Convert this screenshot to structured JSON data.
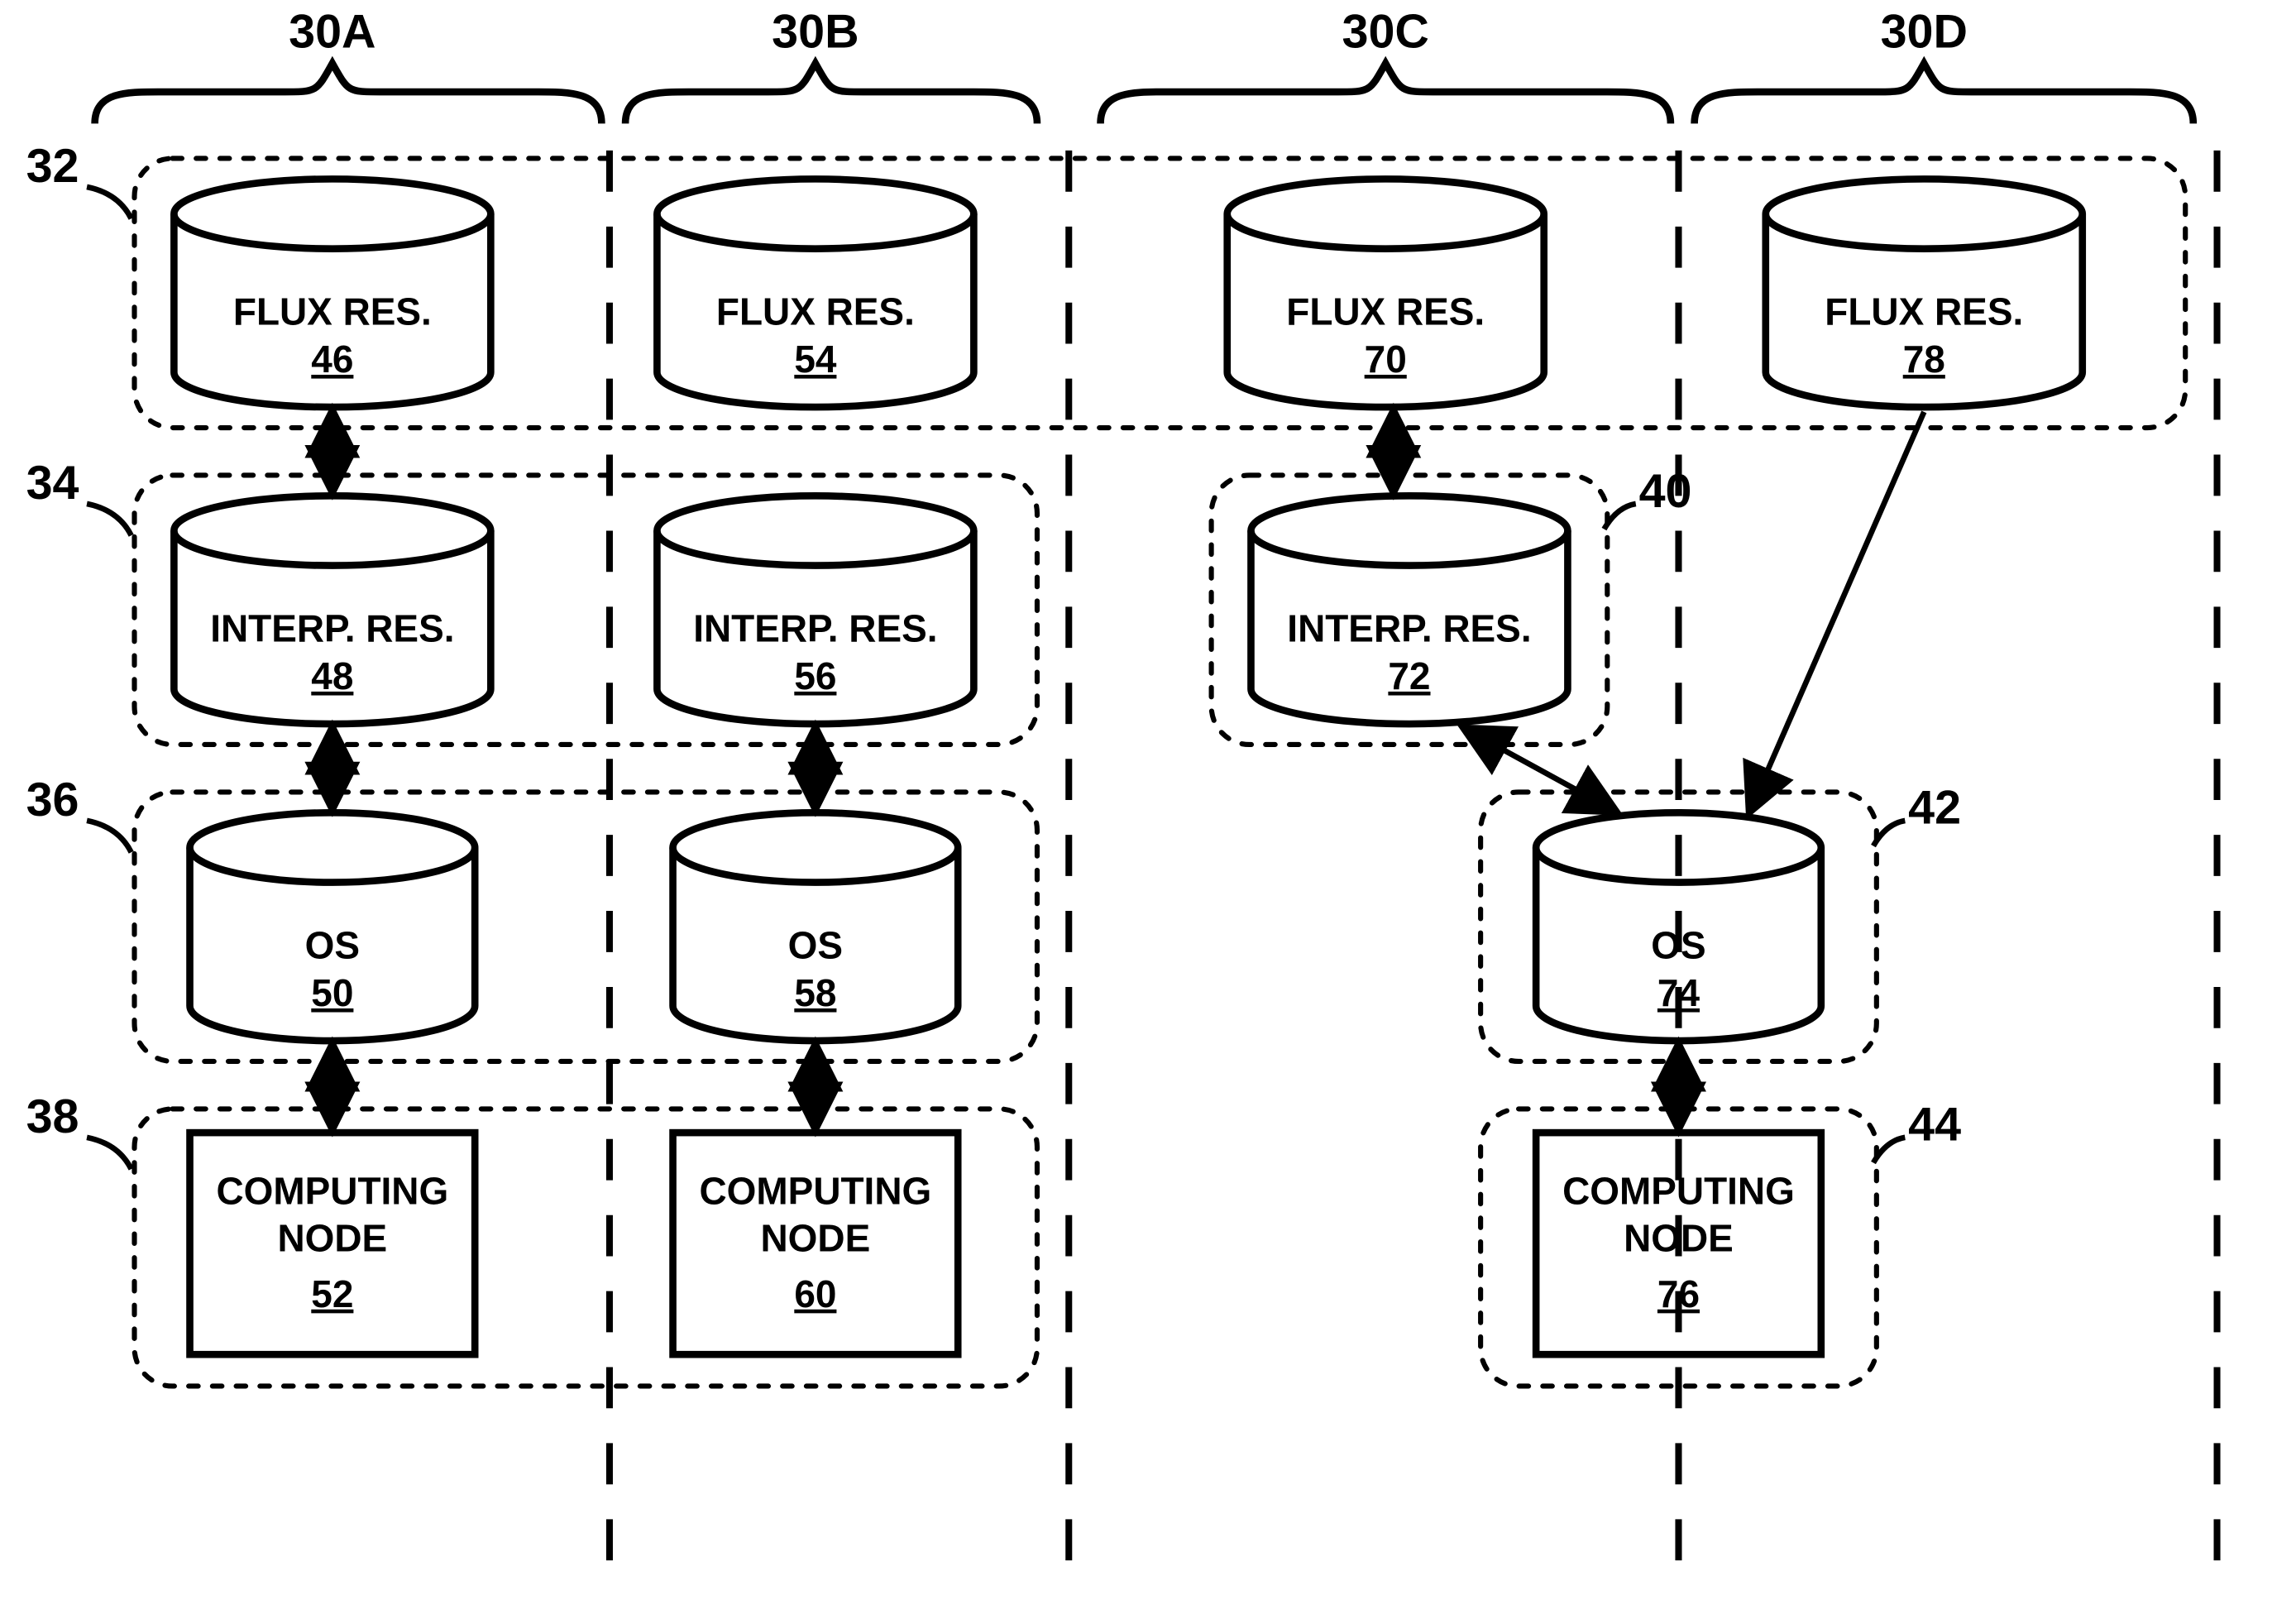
{
  "columns": {
    "A": {
      "header": "30A"
    },
    "B": {
      "header": "30B"
    },
    "C": {
      "header": "30C"
    },
    "D": {
      "header": "30D"
    }
  },
  "rows": {
    "r1": {
      "label": "32"
    },
    "r2": {
      "label": "34"
    },
    "r3": {
      "label": "36"
    },
    "r4": {
      "label": "38"
    }
  },
  "sideLabels": {
    "g40": "40",
    "g42": "42",
    "g44": "44"
  },
  "nodes": {
    "n46": {
      "line1": "FLUX RES.",
      "num": "46"
    },
    "n48": {
      "line1": "INTERP. RES.",
      "num": "48"
    },
    "n50": {
      "line1": "OS",
      "num": "50"
    },
    "n52": {
      "line1": "COMPUTING",
      "line2": "NODE",
      "num": "52"
    },
    "n54": {
      "line1": "FLUX RES.",
      "num": "54"
    },
    "n56": {
      "line1": "INTERP. RES.",
      "num": "56"
    },
    "n58": {
      "line1": "OS",
      "num": "58"
    },
    "n60": {
      "line1": "COMPUTING",
      "line2": "NODE",
      "num": "60"
    },
    "n70": {
      "line1": "FLUX RES.",
      "num": "70"
    },
    "n72": {
      "line1": "INTERP. RES.",
      "num": "72"
    },
    "n74": {
      "line1": "OS",
      "num": "74"
    },
    "n76": {
      "line1": "COMPUTING",
      "line2": "NODE",
      "num": "76"
    },
    "n78": {
      "line1": "FLUX RES.",
      "num": "78"
    }
  }
}
